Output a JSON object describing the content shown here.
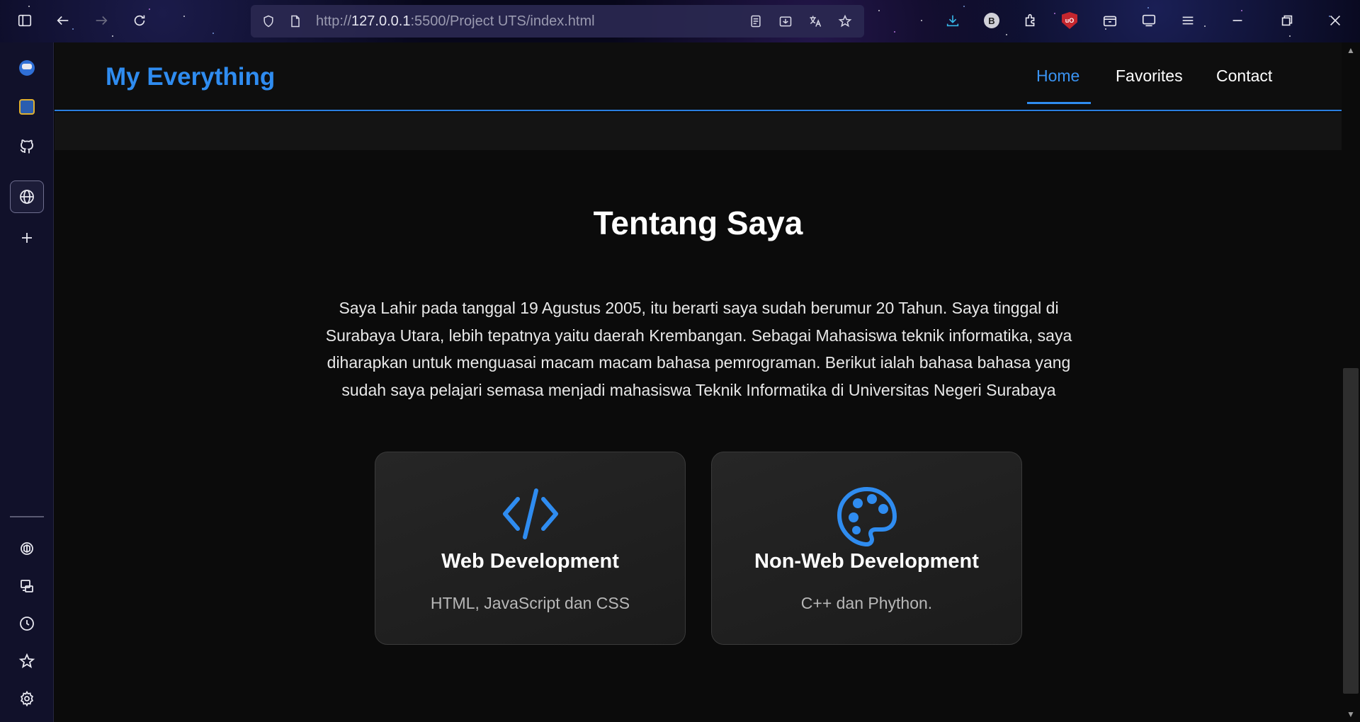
{
  "browser": {
    "url_prefix": "http://",
    "url_host": "127.0.0.1",
    "url_path": ":5500/Project UTS/index.html",
    "profile_badge": "B",
    "ublock_badge": "uO"
  },
  "site": {
    "brand": "My Everything",
    "nav": {
      "home": "Home",
      "favorites": "Favorites",
      "contact": "Contact"
    }
  },
  "about": {
    "title": "Tentang Saya",
    "text": "Saya Lahir pada tanggal 19 Agustus 2005, itu berarti saya sudah berumur 20 Tahun. Saya tinggal di Surabaya Utara, lebih tepatnya yaitu daerah Krembangan. Sebagai Mahasiswa teknik informatika, saya diharapkan untuk menguasai macam macam bahasa pemrograman. Berikut ialah bahasa bahasa yang sudah saya pelajari semasa menjadi mahasiswa Teknik Informatika di Universitas Negeri Surabaya"
  },
  "cards": [
    {
      "icon": "code-icon",
      "title": "Web Development",
      "desc": "HTML, JavaScript dan CSS"
    },
    {
      "icon": "palette-icon",
      "title": "Non-Web Development",
      "desc": "C++ dan Phython."
    }
  ],
  "colors": {
    "accent": "#2f8cf0",
    "page_bg": "#0b0b0b",
    "card_bg": "#222222"
  }
}
